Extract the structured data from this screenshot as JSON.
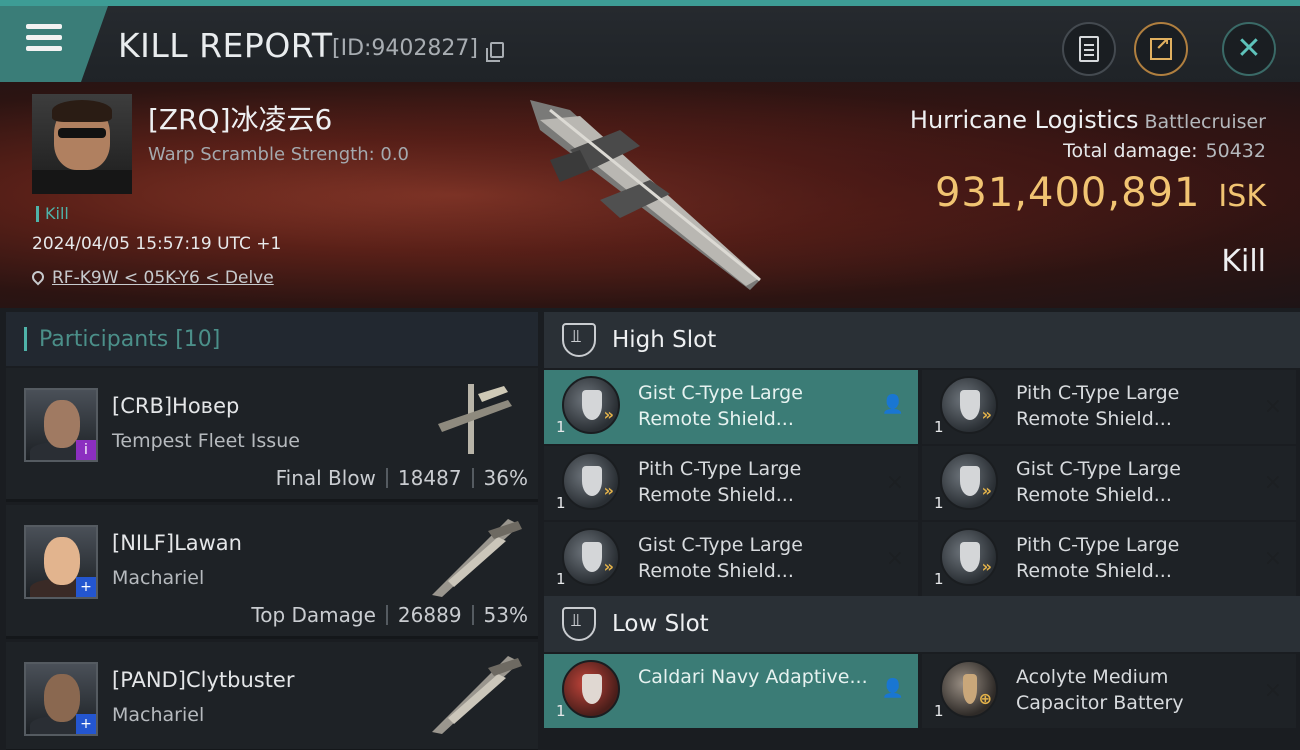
{
  "header": {
    "title": "KILL REPORT",
    "report_id": "[ID:9402827]",
    "icons": {
      "menu": "menu-icon",
      "copy": "copy-icon",
      "clipboard": "clipboard-icon",
      "share": "share-icon",
      "close": "close-icon"
    }
  },
  "victim": {
    "name": "[ZRQ]冰凌云6",
    "warp_scramble": "Warp Scramble Strength: 0.0",
    "tag": "Kill",
    "datetime": "2024/04/05 15:57:19 UTC +1",
    "location": "RF-K9W < 05K-Y6 < Delve",
    "ship_name": "Hurricane Logistics",
    "ship_class": "Battlecruiser",
    "total_damage_label": "Total damage:",
    "total_damage": "50432",
    "isk_value": "931,400,891",
    "isk_unit": "ISK",
    "result": "Kill"
  },
  "participants": {
    "label": "Participants [10]",
    "items": [
      {
        "name": "[CRB]Новер",
        "ship": "Tempest Fleet Issue",
        "role": "Final Blow",
        "damage": "18487",
        "percent": "36%",
        "badge": "i"
      },
      {
        "name": "[NILF]Lawan",
        "ship": "Machariel",
        "role": "Top Damage",
        "damage": "26889",
        "percent": "53%",
        "badge": "+"
      },
      {
        "name": "[PAND]Clytbuster",
        "ship": "Machariel",
        "badge": "+"
      }
    ]
  },
  "high_slot": {
    "label": "High Slot",
    "modules": [
      {
        "name": "Gist C-Type Large Remote Shield...",
        "qty": "1",
        "mark": "person-icon"
      },
      {
        "name": "Pith C-Type Large Remote Shield...",
        "qty": "1",
        "mark": "×"
      },
      {
        "name": "Pith C-Type Large Remote Shield...",
        "qty": "1",
        "mark": "×"
      },
      {
        "name": "Gist C-Type Large Remote Shield...",
        "qty": "1",
        "mark": "×"
      },
      {
        "name": "Gist C-Type Large Remote Shield...",
        "qty": "1",
        "mark": "×"
      },
      {
        "name": "Pith C-Type Large Remote Shield...",
        "qty": "1",
        "mark": "×"
      }
    ]
  },
  "low_slot": {
    "label": "Low Slot",
    "modules": [
      {
        "name": "Caldari Navy Adaptive...",
        "qty": "1",
        "mark": "person-icon"
      },
      {
        "name": "Acolyte Medium Capacitor Battery",
        "qty": "1",
        "mark": "×"
      }
    ]
  },
  "colors": {
    "accent": "#4fb3a9",
    "isk": "#f1c472",
    "active_row": "#3b7c76"
  }
}
